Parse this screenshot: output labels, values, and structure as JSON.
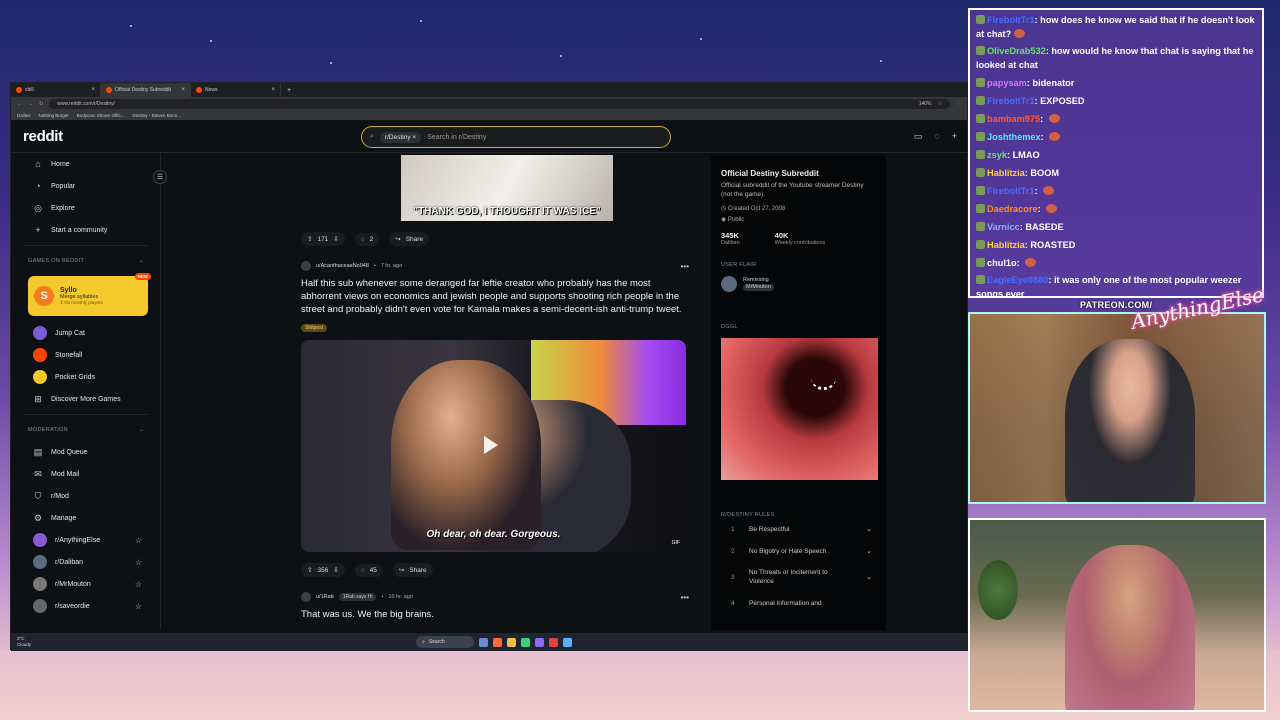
{
  "browser": {
    "tabs": [
      {
        "label": "cbill",
        "active": false
      },
      {
        "label": "Official Destiny Subreddit",
        "active": true
      },
      {
        "label": "News",
        "active": false
      }
    ],
    "url": "www.reddit.com/r/Destiny/",
    "zoom": "140%",
    "bookmarks": [
      "Dailies",
      "Nothing Burger",
      "Bodycam Shows Offic...",
      "Destiny - Steven Bonn..."
    ]
  },
  "header": {
    "logo": "reddit",
    "search_chip": "r/Destiny",
    "search_placeholder": "Search in r/Destiny"
  },
  "sidebar": {
    "nav": [
      {
        "label": "Home",
        "icon": "home-icon"
      },
      {
        "label": "Popular",
        "icon": "popular-icon"
      },
      {
        "label": "Explore",
        "icon": "explore-icon"
      },
      {
        "label": "Start a community",
        "icon": "plus-icon"
      }
    ],
    "games_heading": "GAMES ON REDDIT",
    "featured_game": {
      "name": "Syllo",
      "tagline": "Merge syllables",
      "players": "3.7M monthly players",
      "badge": "NEW"
    },
    "games": [
      "Jump Cat",
      "Stonefall",
      "Pocket Grids",
      "Discover More Games"
    ],
    "mod_heading": "MODERATION",
    "mod": [
      "Mod Queue",
      "Mod Mail",
      "r/Mod",
      "Manage"
    ],
    "communities": [
      "r/AnythingElse",
      "r/Daliban",
      "r/MrMouton",
      "r/saveordie"
    ]
  },
  "feed": {
    "post1": {
      "caption": "\"THANK GOD, I THOUGHT IT WAS ICE\"",
      "votes": "171",
      "comments": "2",
      "share": "Share"
    },
    "post2": {
      "author": "u/AcanthaceaeNo948",
      "time": "7 hr. ago",
      "title": "Half this sub whenever some deranged far leftie creator who probably has the most abhorrent views on economics and jewish people and supports shooting rich people in the street and probably didn't even vote for Kamala makes a semi-decent-ish anti-trump tweet.",
      "flair": "Shitpost",
      "subtitle": "Oh dear, oh dear. Gorgeous.",
      "gif": "GIF",
      "votes": "356",
      "comments": "45",
      "share": "Share"
    },
    "post3": {
      "author": "u/1Rab",
      "flair": "1Rab says Hi",
      "time": "10 hr. ago",
      "title": "That was us. We the big brains."
    }
  },
  "about": {
    "title": "Official Destiny Subreddit",
    "description": "Official subreddit of the Youtube streamer Destiny (not the game).",
    "created": "Created Oct 27, 2008",
    "visibility": "Public",
    "members": "345K",
    "members_label": "Daliban",
    "contributions": "40K",
    "contributions_label": "Weekly contributions",
    "user_flair_heading": "USER FLAIR",
    "flair_name": "Remixxing",
    "flair_user": "MrMouton",
    "dggl_heading": "DGGL",
    "rules_heading": "R/DESTINY RULES",
    "rules": [
      "Be Respectful",
      "No Bigotry or Hate Speech",
      "No Threats or Incitement to Violence",
      "Personal Information and"
    ]
  },
  "taskbar": {
    "temp": "3°C",
    "weather": "Cloudy",
    "search": "Search"
  },
  "chat": [
    {
      "user": "FireboltTr1",
      "color": "#4a6cff",
      "text": "how does he know we said that if he doesn't look at chat?",
      "emote": true
    },
    {
      "user": "OliveDrab532",
      "color": "#6be070",
      "text": "how would he know that chat is saying that he looked at chat",
      "emote": false
    },
    {
      "user": "papysam",
      "color": "#e070ff",
      "text": "bidenator",
      "emote": false
    },
    {
      "user": "FireboltTr1",
      "color": "#4a6cff",
      "text": "EXPOSED",
      "emote": false
    },
    {
      "user": "bambam975",
      "color": "#ff5a3a",
      "text": "",
      "emote": true
    },
    {
      "user": "Joshthemex",
      "color": "#54e8ff",
      "text": "",
      "emote": true
    },
    {
      "user": "zsyk",
      "color": "#6be070",
      "text": "LMAO",
      "emote": false
    },
    {
      "user": "Hablitzia",
      "color": "#ffd33a",
      "text": "BOOM",
      "emote": false
    },
    {
      "user": "FireboltTr1",
      "color": "#4a6cff",
      "text": "",
      "emote": true
    },
    {
      "user": "Daedracore",
      "color": "#ff8a2a",
      "text": "",
      "emote": true
    },
    {
      "user": "Varnicc",
      "color": "#8ab0ff",
      "text": "BASEDE",
      "emote": false
    },
    {
      "user": "Hablitzia",
      "color": "#ffd33a",
      "text": "ROASTED",
      "emote": false
    },
    {
      "user": "chul1o",
      "color": "#ffffff",
      "text": "",
      "emote": true
    },
    {
      "user": "EagleEye0880",
      "color": "#4a6cff",
      "text": "it was only one of the most popular weezer songs ever",
      "emote": false
    }
  ],
  "overlay": {
    "patreon": "PATREON.COM/",
    "signature": "AnythingElse"
  }
}
